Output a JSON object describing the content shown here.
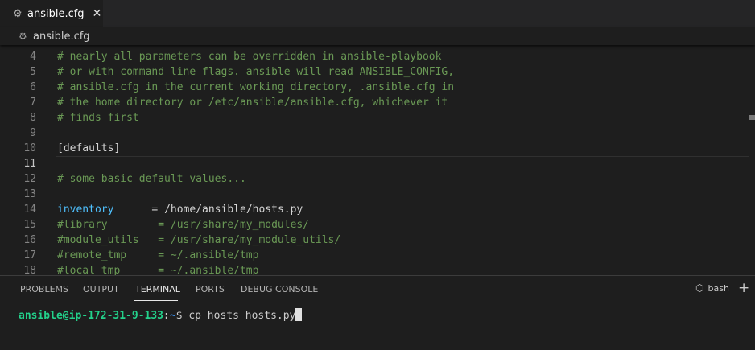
{
  "tab": {
    "icon": "gear-icon",
    "title": "ansible.cfg",
    "close": "✕"
  },
  "breadcrumb": {
    "icon": "gear-icon",
    "title": "ansible.cfg"
  },
  "editor": {
    "lines": [
      {
        "num": "4",
        "segments": [
          {
            "t": "# nearly all parameters can be overridden in ansible-playbook",
            "c": "comment"
          }
        ]
      },
      {
        "num": "5",
        "segments": [
          {
            "t": "# or with command line flags. ansible will read ANSIBLE_CONFIG,",
            "c": "comment"
          }
        ]
      },
      {
        "num": "6",
        "segments": [
          {
            "t": "# ansible.cfg in the current working directory, .ansible.cfg in",
            "c": "comment"
          }
        ]
      },
      {
        "num": "7",
        "segments": [
          {
            "t": "# the home directory or /etc/ansible/ansible.cfg, whichever it",
            "c": "comment"
          }
        ]
      },
      {
        "num": "8",
        "segments": [
          {
            "t": "# finds first",
            "c": "comment"
          }
        ]
      },
      {
        "num": "9",
        "segments": []
      },
      {
        "num": "10",
        "segments": [
          {
            "t": "[defaults]",
            "c": "plain"
          }
        ]
      },
      {
        "num": "11",
        "segments": [],
        "active": true
      },
      {
        "num": "12",
        "segments": [
          {
            "t": "# some basic default values...",
            "c": "comment"
          }
        ]
      },
      {
        "num": "13",
        "segments": []
      },
      {
        "num": "14",
        "segments": [
          {
            "t": "inventory",
            "c": "key"
          },
          {
            "t": "      = /home/ansible/hosts.py",
            "c": "plain"
          }
        ]
      },
      {
        "num": "15",
        "segments": [
          {
            "t": "#library        = /usr/share/my_modules/",
            "c": "comment"
          }
        ]
      },
      {
        "num": "16",
        "segments": [
          {
            "t": "#module_utils   = /usr/share/my_module_utils/",
            "c": "comment"
          }
        ]
      },
      {
        "num": "17",
        "segments": [
          {
            "t": "#remote_tmp     = ~/.ansible/tmp",
            "c": "comment"
          }
        ]
      },
      {
        "num": "18",
        "segments": [
          {
            "t": "#local_tmp      = ~/.ansible/tmp",
            "c": "comment"
          }
        ]
      }
    ]
  },
  "panel": {
    "tabs": [
      "PROBLEMS",
      "OUTPUT",
      "TERMINAL",
      "PORTS",
      "DEBUG CONSOLE"
    ],
    "active_tab": "TERMINAL",
    "shell": "bash",
    "shell_icon": "terminal-icon",
    "add_icon": "plus-icon"
  },
  "terminal": {
    "user": "ansible@ip-172-31-9-133",
    "sep": ":",
    "path": "~",
    "prompt": "$ ",
    "command": "cp hosts hosts.py"
  },
  "colors": {
    "comment": "#6a9955",
    "plain": "#d4d4d4",
    "key": "#4fc1ff",
    "terminal_user": "#23d18b",
    "terminal_path": "#3b8eea"
  }
}
